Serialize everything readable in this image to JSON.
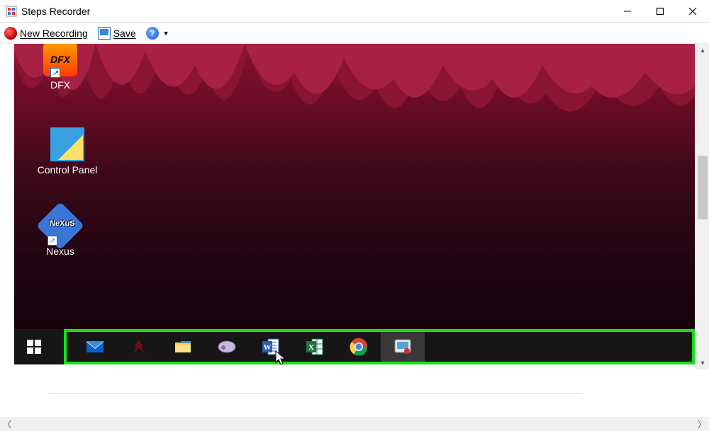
{
  "window": {
    "title": "Steps Recorder"
  },
  "toolbar": {
    "new_recording": "New Recording",
    "save": "Save"
  },
  "desktop_icons": [
    {
      "name": "dfx",
      "label": "DFX"
    },
    {
      "name": "control-panel",
      "label": "Control Panel"
    },
    {
      "name": "nexus",
      "label": "Nexus"
    }
  ],
  "taskbar": {
    "items": [
      {
        "name": "mail",
        "selected": false
      },
      {
        "name": "predator",
        "selected": false
      },
      {
        "name": "file-explorer",
        "selected": false
      },
      {
        "name": "steam",
        "selected": false
      },
      {
        "name": "word",
        "selected": false
      },
      {
        "name": "excel",
        "selected": false
      },
      {
        "name": "chrome",
        "selected": false
      },
      {
        "name": "steps-recorder",
        "selected": true
      }
    ]
  }
}
